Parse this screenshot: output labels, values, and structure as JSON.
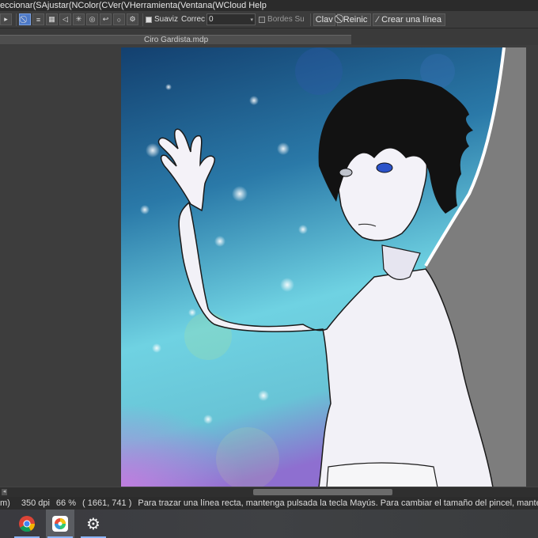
{
  "menubar": {
    "items": [
      "eccionar(S",
      "Ajustar(N",
      "Color(C",
      "Ver(V",
      "Herramienta(",
      "Ventana(W",
      "Cloud",
      "Help"
    ]
  },
  "toolbar": {
    "smooth_label": "Suaviz",
    "correction_label": "Correc",
    "correction_value": "0",
    "edges_label": "Bordes Su",
    "clave_label": "Clav",
    "reset_label": "Reinic",
    "create_line_label": "Crear una línea"
  },
  "document": {
    "tab_title": "Ciro Gardista.mdp"
  },
  "status": {
    "unit": "m)",
    "dpi": "350 dpi",
    "zoom": "66 %",
    "coords": "( 1661, 741 )",
    "hint": "Para trazar una línea recta, mantenga pulsada la tecla Mayús. Para cambiar el tamaño del pincel, mante"
  },
  "taskbar": {
    "apps": [
      "chrome-icon",
      "medibang-icon",
      "settings-icon"
    ]
  },
  "colors": {
    "accent": "#4d79c7",
    "panel": "#3a3a3a",
    "sky_top": "#1c4d86",
    "sky_bottom": "#6fd6e6"
  }
}
